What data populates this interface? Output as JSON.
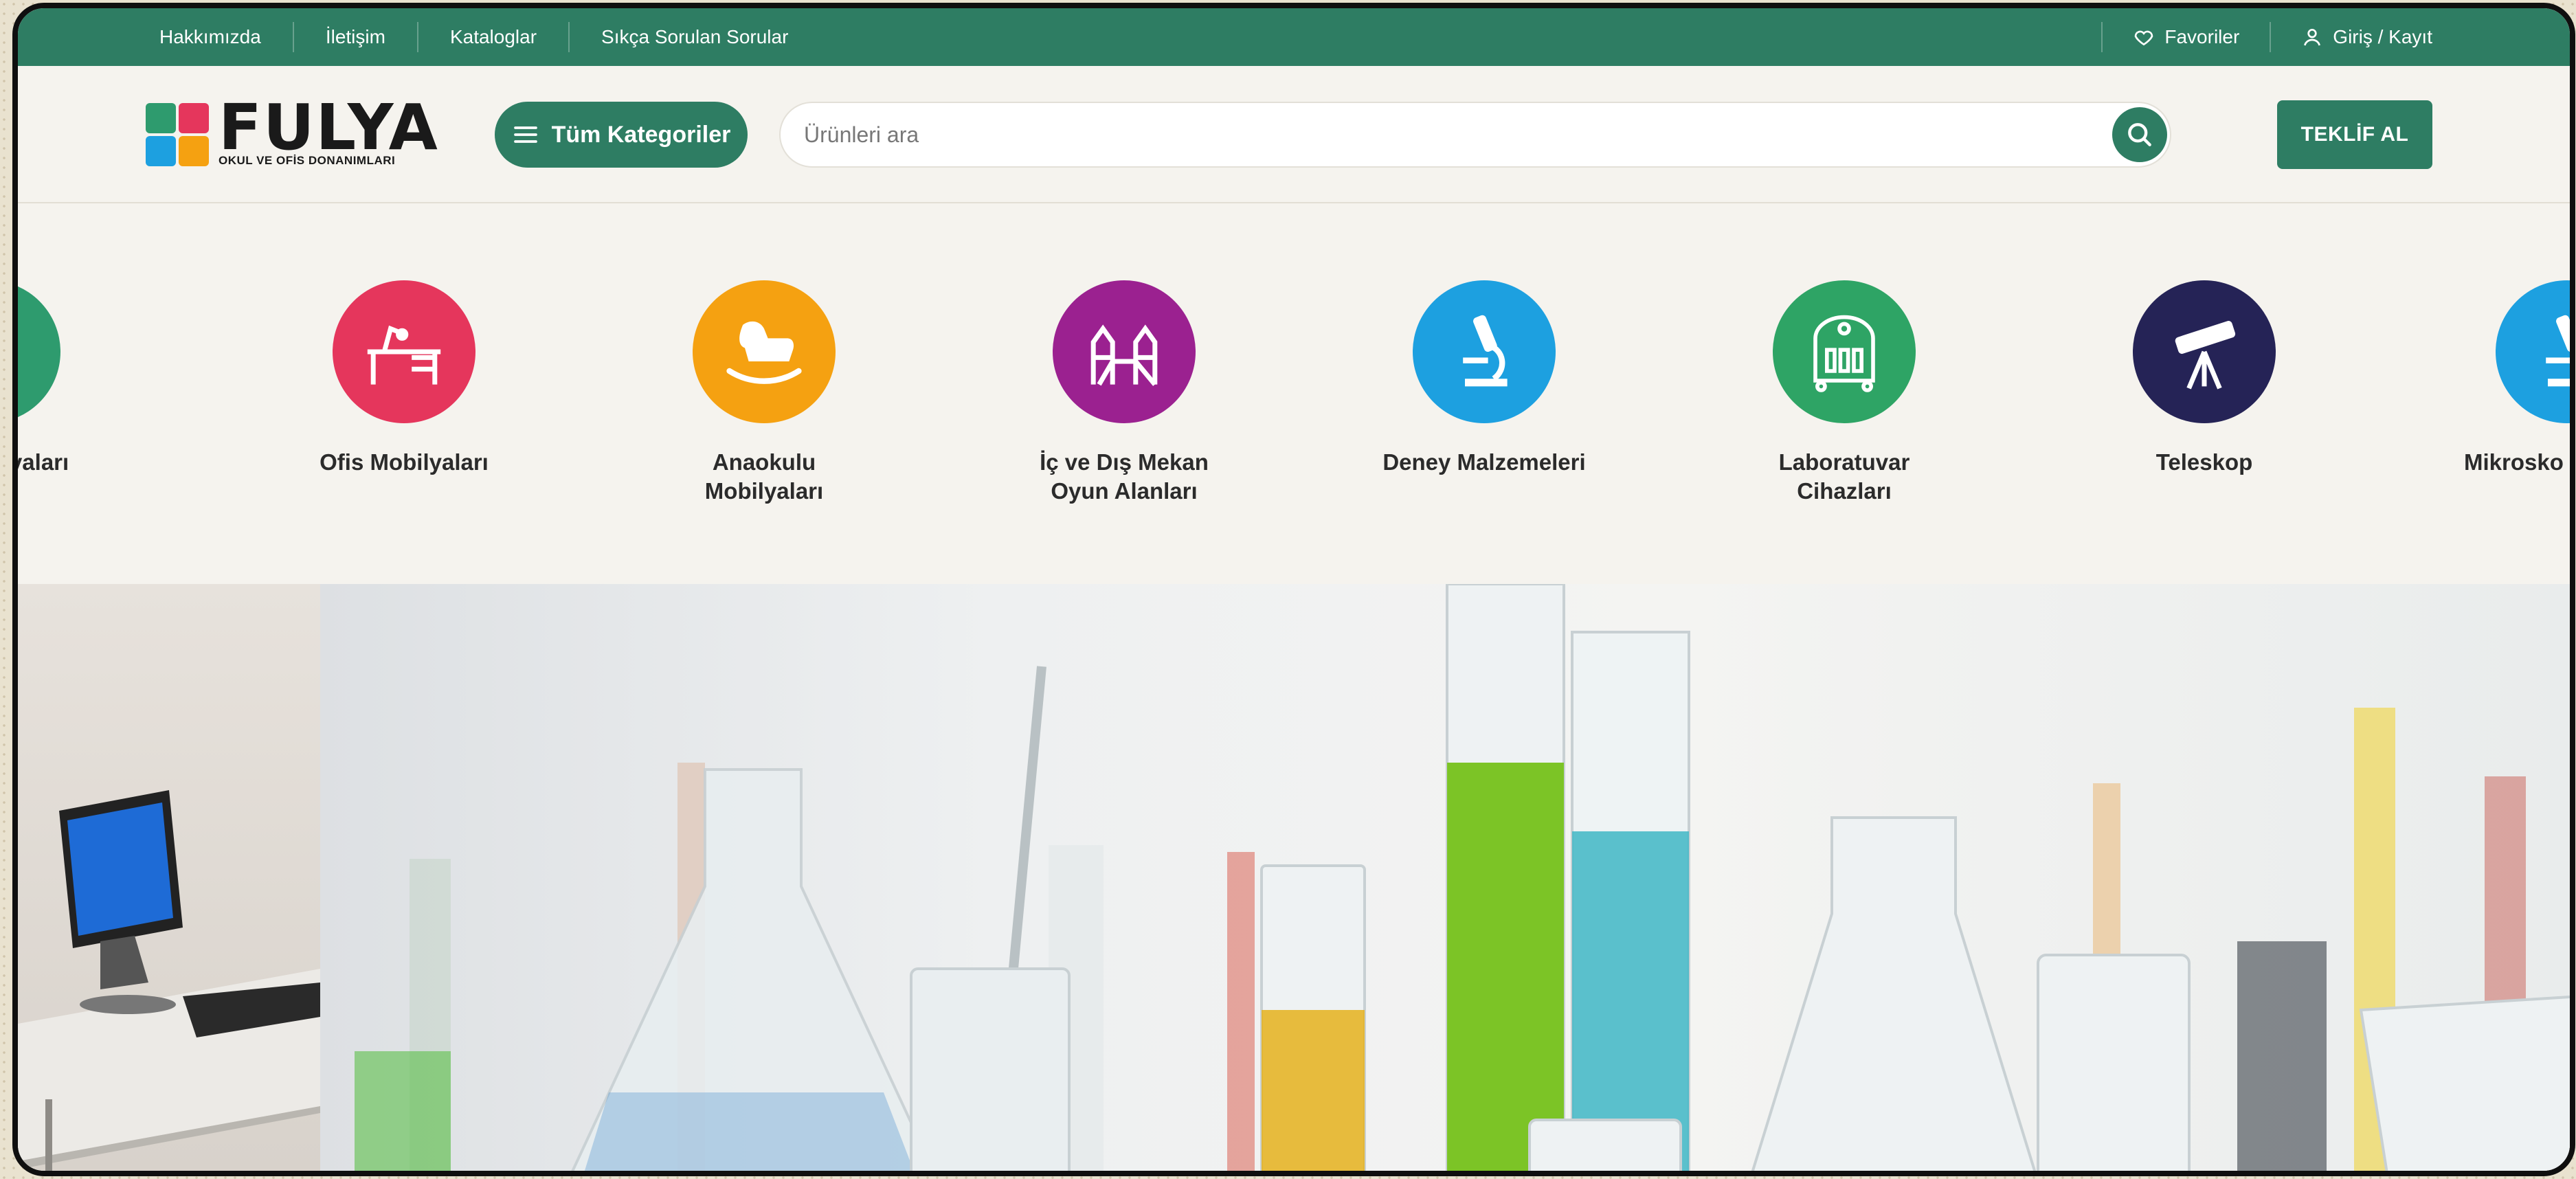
{
  "topbar": {
    "links": [
      "Hakkımızda",
      "İletişim",
      "Kataloglar",
      "Sıkça Sorulan Sorular"
    ],
    "favorites": "Favoriler",
    "login": "Giriş / Kayıt"
  },
  "header": {
    "logo_word": "FULYA",
    "logo_sub": "OKUL VE OFİS DONANIMLARI",
    "categories_button": "Tüm Kategoriler",
    "search_placeholder": "Ürünleri ara",
    "offer_button": "TEKLİF AL"
  },
  "categories": [
    {
      "label": "Mobilyaları",
      "color": "#2e9b6e",
      "icon": "school-desk-icon"
    },
    {
      "label": "Ofis Mobilyaları",
      "color": "#e5365c",
      "icon": "office-desk-icon"
    },
    {
      "label": "Anaokulu Mobilyaları",
      "color": "#f5a111",
      "icon": "rocking-horse-icon"
    },
    {
      "label": "İç ve Dış Mekan Oyun Alanları",
      "color": "#9b2190",
      "icon": "playground-icon"
    },
    {
      "label": "Deney Malzemeleri",
      "color": "#1da0e0",
      "icon": "microscope-icon"
    },
    {
      "label": "Laboratuvar Cihazları",
      "color": "#2ea465",
      "icon": "lab-device-icon"
    },
    {
      "label": "Teleskop",
      "color": "#252356",
      "icon": "telescope-icon"
    },
    {
      "label": "Mikrosko",
      "color": "#1da0e0",
      "icon": "microscope-icon"
    }
  ],
  "colors": {
    "brand": "#2e7d63"
  }
}
